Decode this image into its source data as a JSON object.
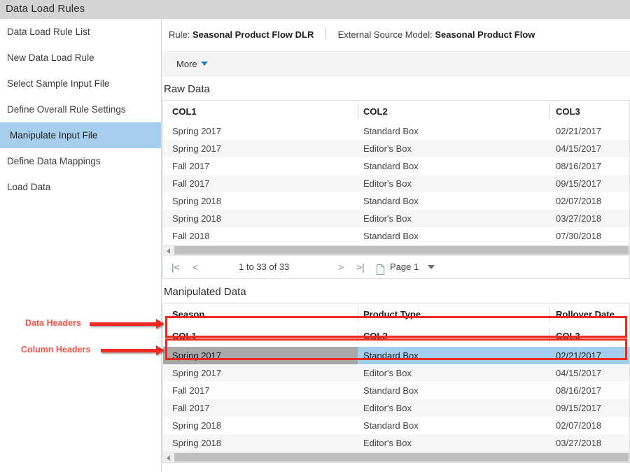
{
  "window": {
    "title": "Data Load Rules"
  },
  "sidebar": {
    "items": [
      {
        "label": "Data Load Rule List",
        "selected": false
      },
      {
        "label": "New Data Load Rule",
        "selected": false
      },
      {
        "label": "Select Sample Input File",
        "selected": false
      },
      {
        "label": "Define Overall Rule Settings",
        "selected": false
      },
      {
        "label": "Manipulate Input File",
        "selected": true
      },
      {
        "label": "Define Data Mappings",
        "selected": false
      },
      {
        "label": "Load Data",
        "selected": false
      }
    ],
    "selected_bg": "#a6cfed"
  },
  "rule_bar": {
    "rule_prefix": "Rule:",
    "rule_name": "Seasonal Product Flow DLR",
    "model_prefix": "External Source Model:",
    "model_name": "Seasonal Product Flow"
  },
  "toolbar": {
    "more_label": "More",
    "caret_icon": "chevron-down-icon",
    "caret_color": "#1b7fd4"
  },
  "raw_data": {
    "title": "Raw Data",
    "column_headers": [
      "COL1",
      "COL2",
      "COL3"
    ],
    "rows": [
      [
        "Spring 2017",
        "Standard Box",
        "02/21/2017"
      ],
      [
        "Spring 2017",
        "Editor's Box",
        "04/15/2017"
      ],
      [
        "Fall 2017",
        "Standard Box",
        "08/16/2017"
      ],
      [
        "Fall 2017",
        "Editor's Box",
        "09/15/2017"
      ],
      [
        "Spring 2018",
        "Standard Box",
        "02/07/2018"
      ],
      [
        "Spring 2018",
        "Editor's Box",
        "03/27/2018"
      ],
      [
        "Fall 2018",
        "Standard Box",
        "07/30/2018"
      ]
    ]
  },
  "pager": {
    "first_icon": "go-to-first-page-icon",
    "prev_icon": "previous-page-icon",
    "range_text": "1 to 33 of 33",
    "next_icon": "next-page-icon",
    "last_icon": "go-to-last-page-icon",
    "page_icon": "page-document-icon",
    "page_label": "Page 1",
    "page_caret_icon": "chevron-down-icon"
  },
  "manipulated_data": {
    "title": "Manipulated Data",
    "data_headers": [
      "Season",
      "Product Type",
      "Rollover Date"
    ],
    "column_headers": [
      "COL1",
      "COL2",
      "COL3"
    ],
    "rows": [
      [
        "Spring 2017",
        "Standard Box",
        "02/21/2017"
      ],
      [
        "Spring 2017",
        "Editor's Box",
        "04/15/2017"
      ],
      [
        "Fall 2017",
        "Standard Box",
        "08/16/2017"
      ],
      [
        "Fall 2017",
        "Editor's Box",
        "09/15/2017"
      ],
      [
        "Spring 2018",
        "Standard Box",
        "02/07/2018"
      ],
      [
        "Spring 2018",
        "Editor's Box",
        "03/27/2018"
      ]
    ],
    "selected_row_index": 0,
    "selection_bg": "#a3cfee",
    "active_cell_bg": "#a8a8a8"
  },
  "annotations": {
    "label_color": "#f4534a",
    "arrow_color": "#ee2a20",
    "items": [
      {
        "label": "Data Headers"
      },
      {
        "label": "Column Headers"
      }
    ]
  }
}
